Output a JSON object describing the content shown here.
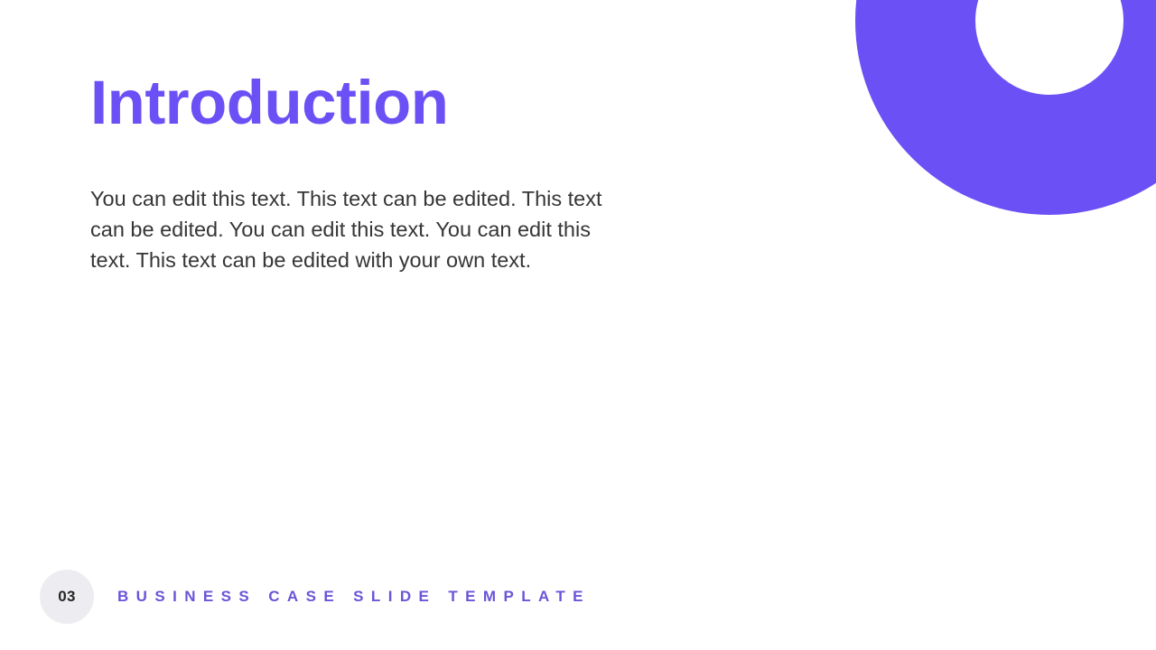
{
  "slide": {
    "title": "Introduction",
    "body": "You can edit this text. This text can be edited. This text can be edited. You can edit this text. You can edit this text. This text can be edited with your own text.",
    "footer": {
      "page_number": "03",
      "template_title": "BUSINESS CASE SLIDE TEMPLATE"
    },
    "decoration": {
      "shape": "ring-arc-icon"
    },
    "colors": {
      "accent_purple": "#6B50F6",
      "footer_purple": "#6B55D8",
      "body_gray": "#363636",
      "badge_bg": "#EDEDF1",
      "badge_text": "#262626",
      "background": "#FFFFFF"
    }
  }
}
